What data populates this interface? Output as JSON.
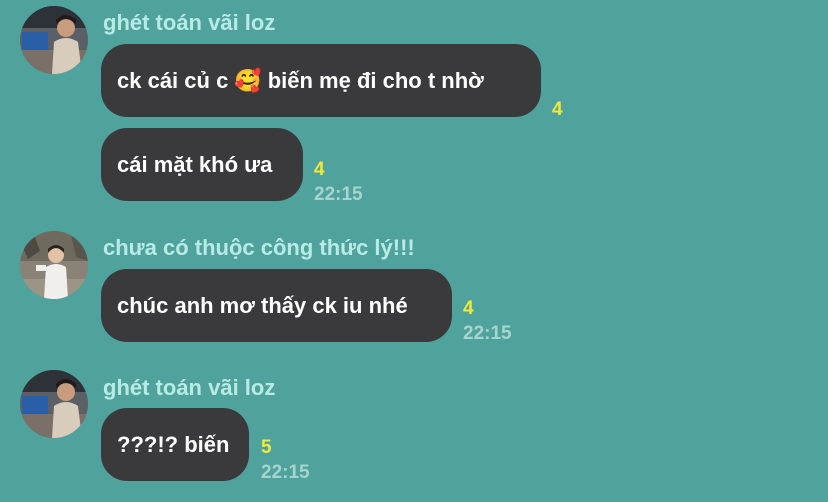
{
  "messages": [
    {
      "sender": "ghét toán vãi loz",
      "avatar": "user-photo-desk",
      "bubbles": [
        {
          "text_before": "ck cái củ c",
          "emoji": "🥰",
          "emoji_name": "smiling-face-with-hearts-emoji",
          "text_after": "biến mẹ đi cho t nhờ",
          "read": "4",
          "time": ""
        },
        {
          "text": "cái mặt khó ưa",
          "read": "4",
          "time": "22:15"
        }
      ]
    },
    {
      "sender": "chưa có thuộc công thức lý!!!",
      "avatar": "user-photo-outdoor",
      "bubbles": [
        {
          "text": "chúc anh mơ thấy ck iu nhé",
          "read": "4",
          "time": "22:15"
        }
      ]
    },
    {
      "sender": "ghét toán vãi loz",
      "avatar": "user-photo-desk",
      "bubbles": [
        {
          "text": "???!? biến",
          "read": "5",
          "time": "22:15"
        }
      ]
    }
  ],
  "colors": {
    "background": "#4fa39c",
    "bubble": "#3a3a3c",
    "sender_name": "#b9ebe6",
    "read_count": "#f2ea3b",
    "timestamp": "#a8d4cf"
  }
}
